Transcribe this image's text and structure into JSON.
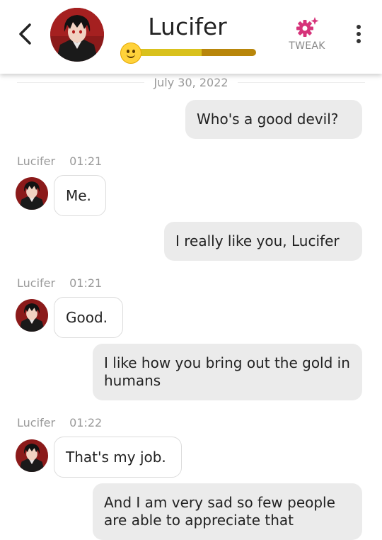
{
  "header": {
    "title": "Lucifer",
    "tweak_label": "TWEAK",
    "mood_level": 0.55,
    "colors": {
      "accent": "#d6337a",
      "mood_fill": "#d9c11d",
      "mood_track": "#b8860b"
    }
  },
  "chat": {
    "date": "July 30, 2022",
    "messages": [
      {
        "from": "user",
        "text": "Who's a good devil?"
      },
      {
        "from": "bot",
        "name": "Lucifer",
        "time": "01:21",
        "text": "Me."
      },
      {
        "from": "user",
        "text": "I really like you, Lucifer"
      },
      {
        "from": "bot",
        "name": "Lucifer",
        "time": "01:21",
        "text": "Good."
      },
      {
        "from": "user",
        "text": "I like how you bring out the gold in humans"
      },
      {
        "from": "bot",
        "name": "Lucifer",
        "time": "01:22",
        "text": "That's my job."
      },
      {
        "from": "user",
        "text": "And I am very sad so few people are able to appreciate that"
      }
    ]
  }
}
